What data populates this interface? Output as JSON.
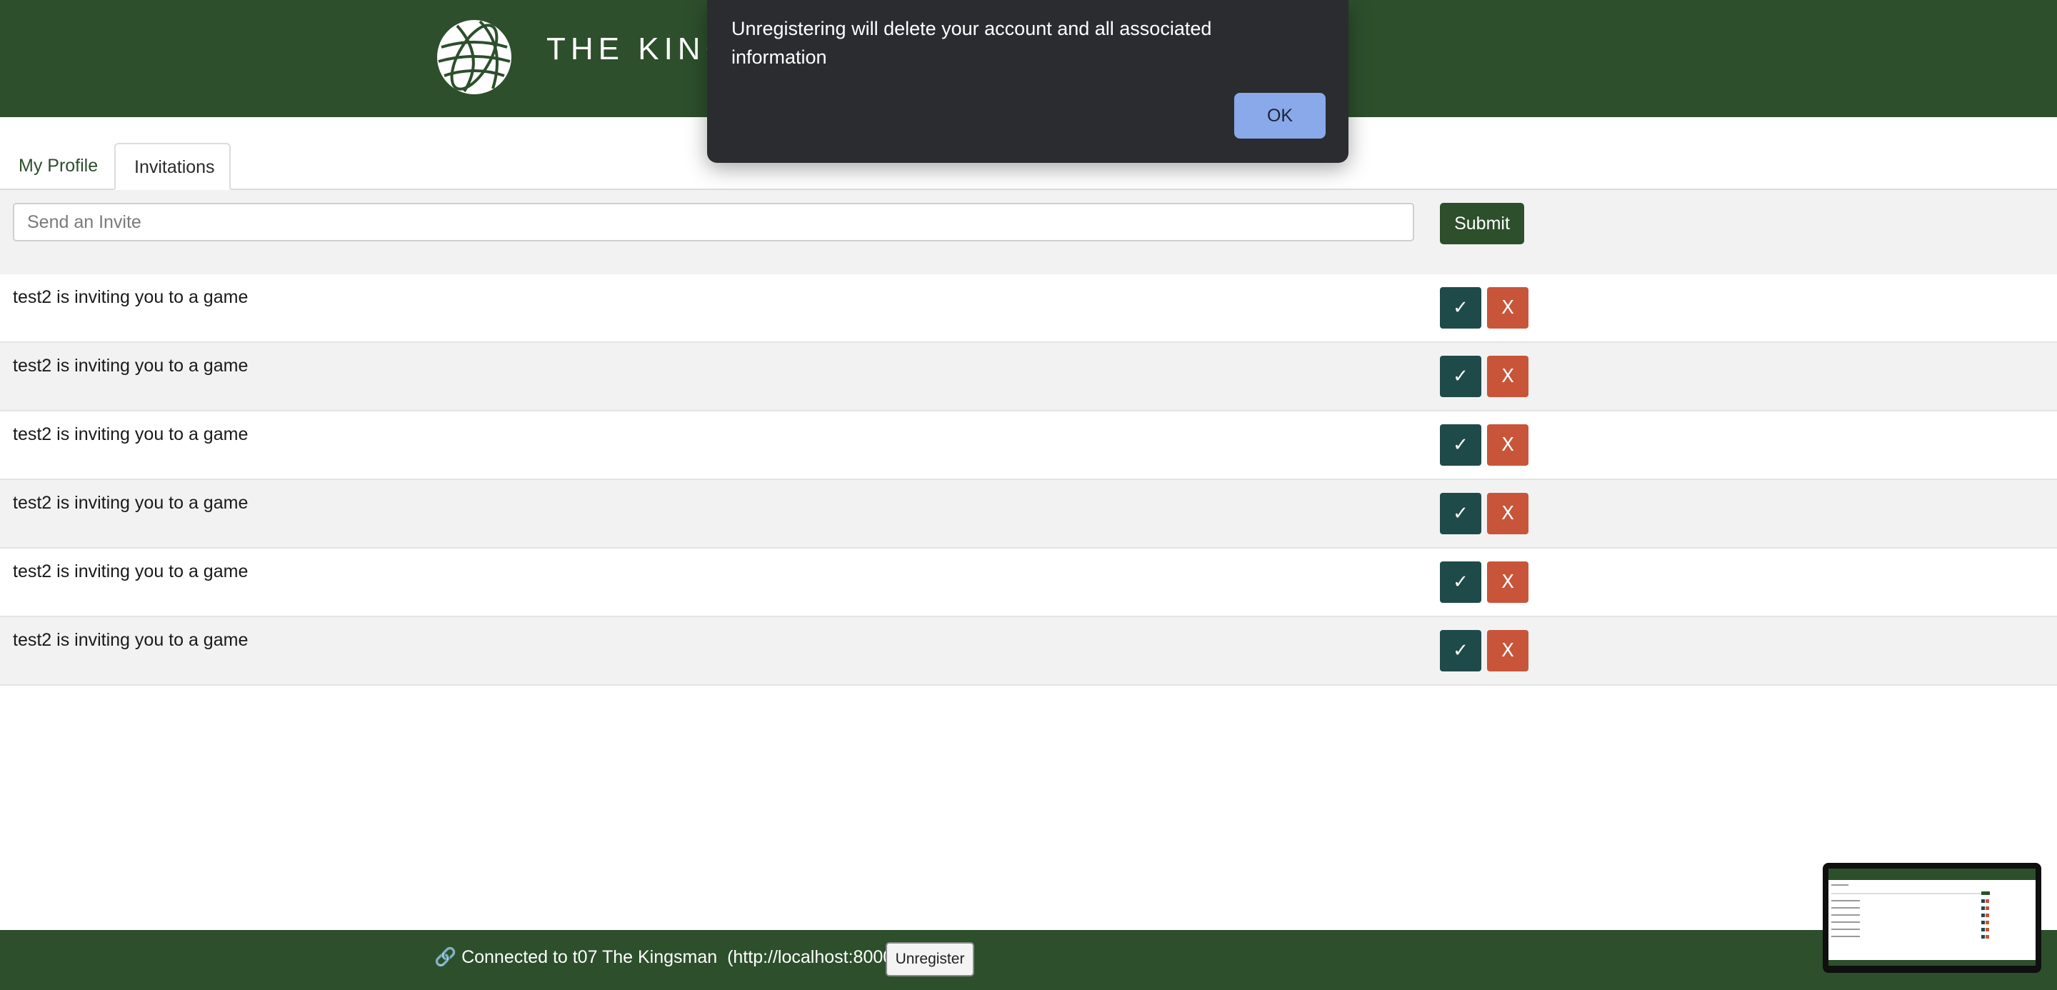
{
  "header": {
    "brand": "THE KINGS"
  },
  "tabs": [
    {
      "label": "My Profile"
    },
    {
      "label": "Invitations"
    }
  ],
  "invite": {
    "placeholder": "Send an Invite",
    "submit_label": "Submit"
  },
  "invitations": [
    {
      "text": "test2 is inviting you to a game",
      "accept": "✓",
      "decline": "X"
    },
    {
      "text": "test2 is inviting you to a game",
      "accept": "✓",
      "decline": "X"
    },
    {
      "text": "test2 is inviting you to a game",
      "accept": "✓",
      "decline": "X"
    },
    {
      "text": "test2 is inviting you to a game",
      "accept": "✓",
      "decline": "X"
    },
    {
      "text": "test2 is inviting you to a game",
      "accept": "✓",
      "decline": "X"
    },
    {
      "text": "test2 is inviting you to a game",
      "accept": "✓",
      "decline": "X"
    }
  ],
  "footer": {
    "status": "🔗 Connected to t07 The Kingsman  (http://localhost:8000).",
    "unregister_label": "Unregister"
  },
  "dialog": {
    "message": "Unregistering will delete your account and all associated information",
    "ok_label": "OK"
  },
  "colors": {
    "header_green": "#2d4f2c",
    "accept_teal": "#1f4a4a",
    "decline_orange": "#c8553a",
    "ok_blue": "#8aa9ea"
  }
}
